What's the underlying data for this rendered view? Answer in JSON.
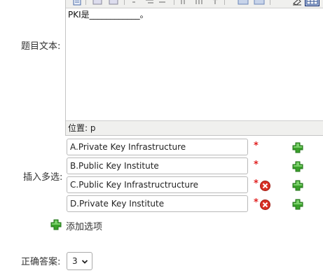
{
  "labels": {
    "question_text": "题目文本:",
    "options": "插入多选:",
    "correct_answer": "正确答案:"
  },
  "editor": {
    "content": "PKI是____________。",
    "status_label": "位置:",
    "status_path": "p",
    "toolbar_icons": [
      "paste-icon",
      "bold-icon",
      "italic-icon",
      "align-icon",
      "indent-icon",
      "list-icon",
      "table-icon",
      "link-icon",
      "undo-icon",
      "source-icon"
    ]
  },
  "options": [
    {
      "value": "A.Private Key Infrastructure",
      "required_mark": "*",
      "deletable": false
    },
    {
      "value": "B.Public Key Institute",
      "required_mark": "*",
      "deletable": false
    },
    {
      "value": "C.Public Key Infrastructructure",
      "required_mark": "*",
      "deletable": true
    },
    {
      "value": "D.Private Key Institute",
      "required_mark": "*",
      "deletable": true
    }
  ],
  "add_option_label": "添加选项",
  "answer": {
    "selected": "3"
  },
  "colors": {
    "required": "#e02020",
    "add_green": "#3aa12a",
    "delete_red": "#d93025"
  }
}
